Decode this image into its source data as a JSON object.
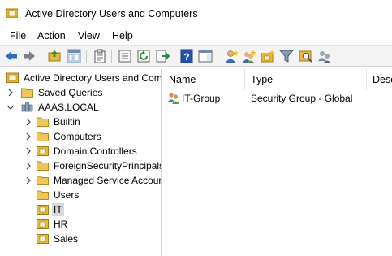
{
  "window": {
    "title": "Active Directory Users and Computers",
    "icon": "ad-folder-icon"
  },
  "menu": [
    "File",
    "Action",
    "View",
    "Help"
  ],
  "toolbar": {
    "buttons": [
      "back-arrow-icon",
      "forward-arrow-icon",
      "up-folder-icon",
      "show-hide-tree-icon",
      "clipboard-icon",
      "properties-icon",
      "refresh-icon",
      "export-list-icon",
      "help-icon",
      "action-pane-icon",
      "new-user-icon",
      "new-group-icon",
      "new-ou-icon",
      "filter-icon",
      "find-icon",
      "add-to-group-icon"
    ]
  },
  "tree": {
    "root": "Active Directory Users and Com",
    "items": [
      {
        "label": "Saved Queries"
      },
      {
        "label": "AAAS.LOCAL"
      },
      {
        "label": "Builtin"
      },
      {
        "label": "Computers"
      },
      {
        "label": "Domain Controllers"
      },
      {
        "label": "ForeignSecurityPrincipals"
      },
      {
        "label": "Managed Service Accour"
      },
      {
        "label": "Users"
      },
      {
        "label": "IT"
      },
      {
        "label": "HR"
      },
      {
        "label": "Sales"
      }
    ],
    "selected": "IT"
  },
  "list": {
    "columns": [
      "Name",
      "Type",
      "Desc"
    ],
    "rows": [
      {
        "name": "IT-Group",
        "type": "Security Group - Global",
        "icon": "group-icon"
      }
    ]
  },
  "colors": {
    "accent": "#2b6fc2",
    "folder": "#e8b83a",
    "selection": "#d9d9d9"
  }
}
